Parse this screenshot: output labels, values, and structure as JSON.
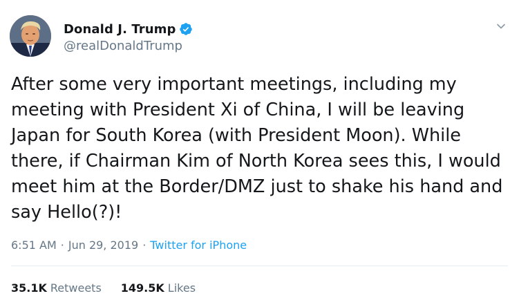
{
  "tweet": {
    "author": {
      "display_name": "Donald J. Trump",
      "handle": "@realDonaldTrump",
      "verified": true,
      "avatar_icon": "profile-photo"
    },
    "text": "After some very important meetings, including my meeting with President Xi of China, I will be leaving Japan for South Korea (with President Moon). While there, if Chairman Kim of North Korea sees this, I would meet him at the Border/DMZ just to shake his hand and say Hello(?)!",
    "time": "6:51 AM",
    "date": "Jun 29, 2019",
    "separator": "·",
    "source": "Twitter for iPhone",
    "retweets_count": "35.1K",
    "retweets_label": "Retweets",
    "likes_count": "149.5K",
    "likes_label": "Likes"
  },
  "colors": {
    "accent": "#1da1f2",
    "text": "#14171a",
    "secondary": "#657786",
    "divider": "#e6ecf0"
  },
  "icons": {
    "verified": "verified-badge-icon",
    "more": "chevron-down-icon"
  }
}
